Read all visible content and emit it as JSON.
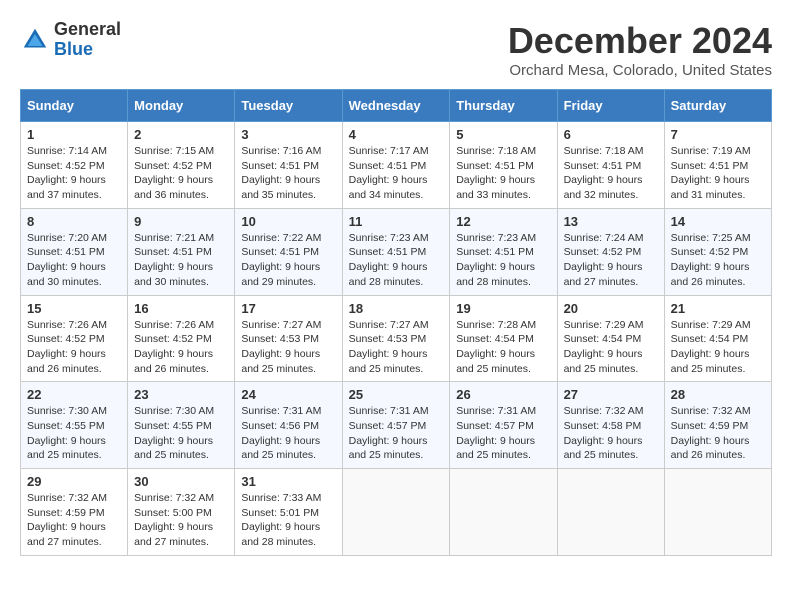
{
  "logo": {
    "general": "General",
    "blue": "Blue"
  },
  "title": "December 2024",
  "location": "Orchard Mesa, Colorado, United States",
  "days_of_week": [
    "Sunday",
    "Monday",
    "Tuesday",
    "Wednesday",
    "Thursday",
    "Friday",
    "Saturday"
  ],
  "weeks": [
    [
      {
        "day": "1",
        "sunrise": "7:14 AM",
        "sunset": "4:52 PM",
        "daylight": "9 hours and 37 minutes."
      },
      {
        "day": "2",
        "sunrise": "7:15 AM",
        "sunset": "4:52 PM",
        "daylight": "9 hours and 36 minutes."
      },
      {
        "day": "3",
        "sunrise": "7:16 AM",
        "sunset": "4:51 PM",
        "daylight": "9 hours and 35 minutes."
      },
      {
        "day": "4",
        "sunrise": "7:17 AM",
        "sunset": "4:51 PM",
        "daylight": "9 hours and 34 minutes."
      },
      {
        "day": "5",
        "sunrise": "7:18 AM",
        "sunset": "4:51 PM",
        "daylight": "9 hours and 33 minutes."
      },
      {
        "day": "6",
        "sunrise": "7:18 AM",
        "sunset": "4:51 PM",
        "daylight": "9 hours and 32 minutes."
      },
      {
        "day": "7",
        "sunrise": "7:19 AM",
        "sunset": "4:51 PM",
        "daylight": "9 hours and 31 minutes."
      }
    ],
    [
      {
        "day": "8",
        "sunrise": "7:20 AM",
        "sunset": "4:51 PM",
        "daylight": "9 hours and 30 minutes."
      },
      {
        "day": "9",
        "sunrise": "7:21 AM",
        "sunset": "4:51 PM",
        "daylight": "9 hours and 30 minutes."
      },
      {
        "day": "10",
        "sunrise": "7:22 AM",
        "sunset": "4:51 PM",
        "daylight": "9 hours and 29 minutes."
      },
      {
        "day": "11",
        "sunrise": "7:23 AM",
        "sunset": "4:51 PM",
        "daylight": "9 hours and 28 minutes."
      },
      {
        "day": "12",
        "sunrise": "7:23 AM",
        "sunset": "4:51 PM",
        "daylight": "9 hours and 28 minutes."
      },
      {
        "day": "13",
        "sunrise": "7:24 AM",
        "sunset": "4:52 PM",
        "daylight": "9 hours and 27 minutes."
      },
      {
        "day": "14",
        "sunrise": "7:25 AM",
        "sunset": "4:52 PM",
        "daylight": "9 hours and 26 minutes."
      }
    ],
    [
      {
        "day": "15",
        "sunrise": "7:26 AM",
        "sunset": "4:52 PM",
        "daylight": "9 hours and 26 minutes."
      },
      {
        "day": "16",
        "sunrise": "7:26 AM",
        "sunset": "4:52 PM",
        "daylight": "9 hours and 26 minutes."
      },
      {
        "day": "17",
        "sunrise": "7:27 AM",
        "sunset": "4:53 PM",
        "daylight": "9 hours and 25 minutes."
      },
      {
        "day": "18",
        "sunrise": "7:27 AM",
        "sunset": "4:53 PM",
        "daylight": "9 hours and 25 minutes."
      },
      {
        "day": "19",
        "sunrise": "7:28 AM",
        "sunset": "4:54 PM",
        "daylight": "9 hours and 25 minutes."
      },
      {
        "day": "20",
        "sunrise": "7:29 AM",
        "sunset": "4:54 PM",
        "daylight": "9 hours and 25 minutes."
      },
      {
        "day": "21",
        "sunrise": "7:29 AM",
        "sunset": "4:54 PM",
        "daylight": "9 hours and 25 minutes."
      }
    ],
    [
      {
        "day": "22",
        "sunrise": "7:30 AM",
        "sunset": "4:55 PM",
        "daylight": "9 hours and 25 minutes."
      },
      {
        "day": "23",
        "sunrise": "7:30 AM",
        "sunset": "4:55 PM",
        "daylight": "9 hours and 25 minutes."
      },
      {
        "day": "24",
        "sunrise": "7:31 AM",
        "sunset": "4:56 PM",
        "daylight": "9 hours and 25 minutes."
      },
      {
        "day": "25",
        "sunrise": "7:31 AM",
        "sunset": "4:57 PM",
        "daylight": "9 hours and 25 minutes."
      },
      {
        "day": "26",
        "sunrise": "7:31 AM",
        "sunset": "4:57 PM",
        "daylight": "9 hours and 25 minutes."
      },
      {
        "day": "27",
        "sunrise": "7:32 AM",
        "sunset": "4:58 PM",
        "daylight": "9 hours and 25 minutes."
      },
      {
        "day": "28",
        "sunrise": "7:32 AM",
        "sunset": "4:59 PM",
        "daylight": "9 hours and 26 minutes."
      }
    ],
    [
      {
        "day": "29",
        "sunrise": "7:32 AM",
        "sunset": "4:59 PM",
        "daylight": "9 hours and 27 minutes."
      },
      {
        "day": "30",
        "sunrise": "7:32 AM",
        "sunset": "5:00 PM",
        "daylight": "9 hours and 27 minutes."
      },
      {
        "day": "31",
        "sunrise": "7:33 AM",
        "sunset": "5:01 PM",
        "daylight": "9 hours and 28 minutes."
      },
      null,
      null,
      null,
      null
    ]
  ]
}
